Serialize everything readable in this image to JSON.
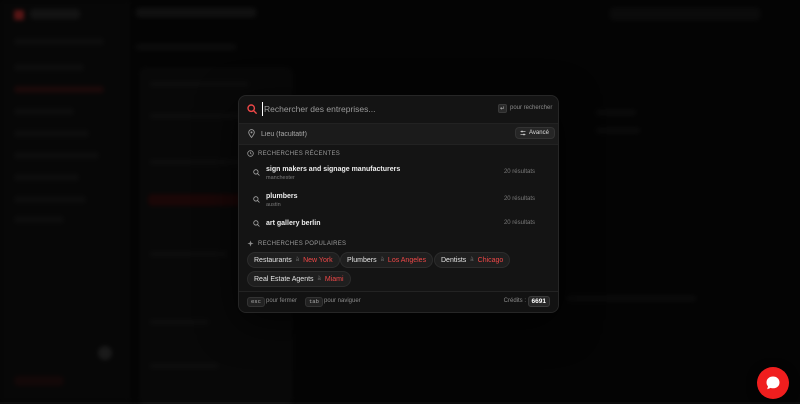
{
  "search": {
    "placeholder": "Rechercher des entreprises...",
    "hint_key": "↵",
    "hint_text": "pour rechercher"
  },
  "location": {
    "placeholder": "Lieu (facultatif)",
    "advanced_label": "Avancé"
  },
  "recent": {
    "title": "RECHERCHES RÉCENTES",
    "items": [
      {
        "query": "sign makers and signage manufacturers",
        "location": "manchester",
        "results": "20 résultats"
      },
      {
        "query": "plumbers",
        "location": "austin",
        "results": "20 résultats"
      },
      {
        "query": "art gallery berlin",
        "location": "",
        "results": "20 résultats"
      }
    ]
  },
  "popular": {
    "title": "RECHERCHES POPULAIRES",
    "amp": "à",
    "chips": [
      {
        "term": "Restaurants",
        "city": "New York"
      },
      {
        "term": "Plumbers",
        "city": "Los Angeles"
      },
      {
        "term": "Dentists",
        "city": "Chicago"
      },
      {
        "term": "Real Estate Agents",
        "city": "Miami"
      }
    ]
  },
  "footer": {
    "esc_key": "esc",
    "esc_label": "pour fermer",
    "tab_key": "tab",
    "tab_label": "pour naviguer",
    "credits_label": "Crédits :",
    "credits_value": "6691"
  },
  "colors": {
    "accent": "#f04848",
    "chat_button": "#f01e1e",
    "modal_bg": "#141414"
  },
  "icons": {
    "search": "search-icon",
    "pin": "map-pin-icon",
    "clock": "clock-icon",
    "sparkle": "sparkle-icon",
    "advanced": "sliders-icon",
    "chat": "chat-bubble-icon"
  }
}
